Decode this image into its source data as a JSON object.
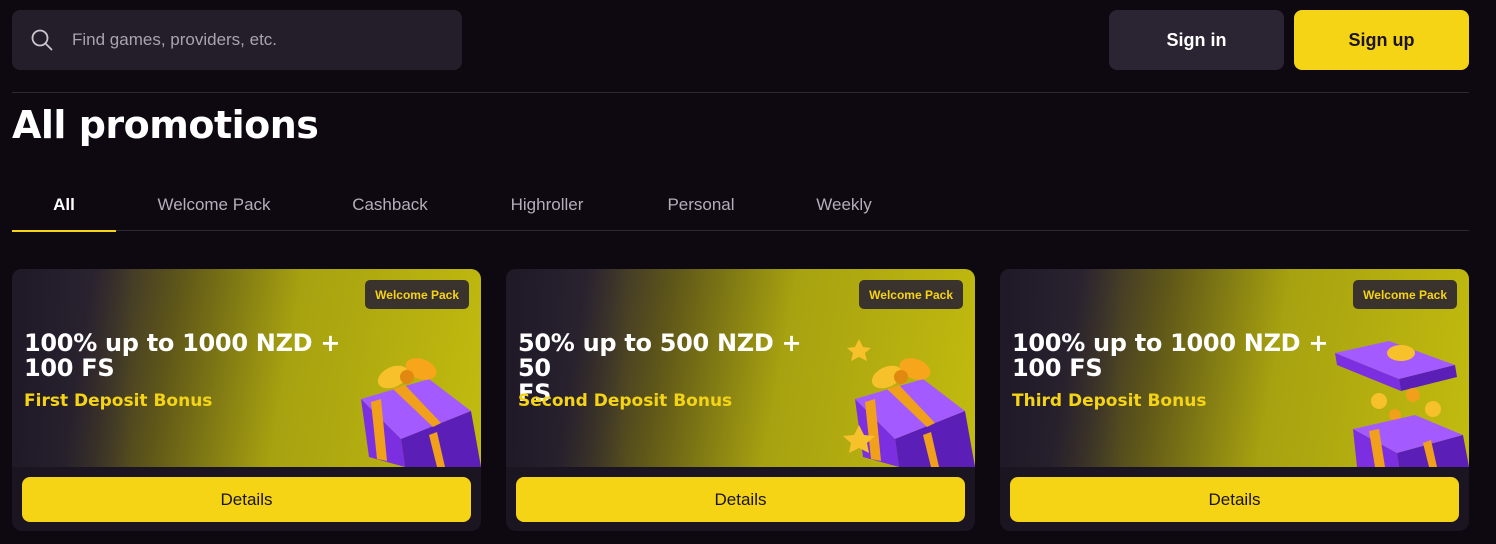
{
  "header": {
    "search": {
      "placeholder": "Find games, providers, etc.",
      "icon": "search-icon"
    },
    "sign_in_label": "Sign in",
    "sign_up_label": "Sign up"
  },
  "page": {
    "title": "All promotions"
  },
  "tabs": [
    {
      "label": "All",
      "active": true
    },
    {
      "label": "Welcome Pack",
      "active": false
    },
    {
      "label": "Cashback",
      "active": false
    },
    {
      "label": "Highroller",
      "active": false
    },
    {
      "label": "Personal",
      "active": false
    },
    {
      "label": "Weekly",
      "active": false
    }
  ],
  "promotions": [
    {
      "badge": "Welcome Pack",
      "offer_line1": "100% up to 1000 NZD +",
      "offer_line2": "100 FS",
      "subtitle": "First Deposit Bonus",
      "button_label": "Details",
      "image": "gift-box-icon"
    },
    {
      "badge": "Welcome Pack",
      "offer_line1": "50% up to 500 NZD + 50",
      "offer_line2": "FS",
      "subtitle": "Second Deposit Bonus",
      "button_label": "Details",
      "image": "gift-box-stars-icon"
    },
    {
      "badge": "Welcome Pack",
      "offer_line1": "100% up to 1000 NZD +",
      "offer_line2": "100 FS",
      "subtitle": "Third Deposit Bonus",
      "button_label": "Details",
      "image": "open-gift-coins-icon"
    }
  ],
  "colors": {
    "background": "#0e0811",
    "accent": "#f5d416",
    "surface": "#241e2b",
    "card": "#1b1522"
  }
}
